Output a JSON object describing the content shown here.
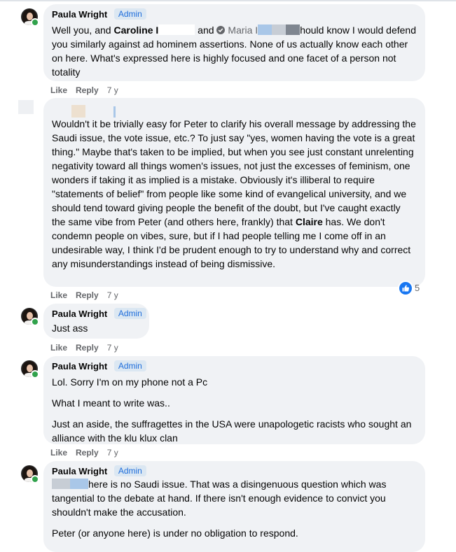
{
  "comments": [
    {
      "author": "Paula Wright",
      "badge": "Admin",
      "text": {
        "p1_a": "Well you, and ",
        "p1_mention1": "Caroline I",
        "p1_b": " and ",
        "p1_mention2": "Maria I",
        "p1_c": "hould know I would defend you similarly against ad hominem assertions. None of us actually know each other on here. What's expressed here is highly focused and one facet of a person not totality"
      },
      "like": "Like",
      "reply": "Reply",
      "time": "7 y"
    },
    {
      "text": {
        "p1_a": "Wouldn't it be trivially easy for Peter to clarify his overall message by addressing the Saudi issue, the vote issue, etc.? To just say \"yes, women having the vote is a great thing.\" Maybe that's taken to be implied, but when you see just constant unrelenting negativity toward all things women's issues, not just the excesses of feminism, one wonders if taking it as implied is a mistake. Obviously it's illiberal to require \"statements of belief\" from people like some kind of evangelical university, and we should tend toward giving people the benefit of the doubt, but I've caught exactly the same vibe from Peter (and others here, frankly) that ",
        "p1_mention": "Claire",
        "p1_b": " has. We don't condemn people on vibes, sure, but if I had people telling me I come off in an undesirable way, I think I'd be prudent enough to try to understand why and correct any misunderstandings instead of being dismissive."
      },
      "reactions": "5",
      "like": "Like",
      "reply": "Reply",
      "time": "7 y"
    },
    {
      "author": "Paula Wright",
      "badge": "Admin",
      "text": {
        "p1": "Just ass"
      },
      "like": "Like",
      "reply": "Reply",
      "time": "7 y"
    },
    {
      "author": "Paula Wright",
      "badge": "Admin",
      "text": {
        "p1": "Lol. Sorry I'm on my phone not a Pc",
        "p2": "What I meant to write was..",
        "p3": "Just an aside, the suffragettes in the USA were unapologetic racists who sought an alliance with the klu klux clan"
      },
      "like": "Like",
      "reply": "Reply",
      "time": "7 y"
    },
    {
      "author": "Paula Wright",
      "badge": "Admin",
      "text": {
        "p1": "here is no Saudi issue. That was a disingenuous question which was tangential to the debate at hand. If there isn't enough evidence to convict you shouldn't make the accusation.",
        "p2": "Peter (or anyone here) is under no obligation to respond."
      }
    }
  ],
  "colors": {
    "bubble": "#f0f2f5",
    "admin_badge_text": "#216fdb",
    "admin_badge_bg": "#dbe7f2",
    "meta_text": "#65676b",
    "like_blue": "#1877f2",
    "online_green": "#31a24c"
  },
  "icons": [
    "avatar",
    "online-dot",
    "verified-icon",
    "like-reaction-icon"
  ]
}
